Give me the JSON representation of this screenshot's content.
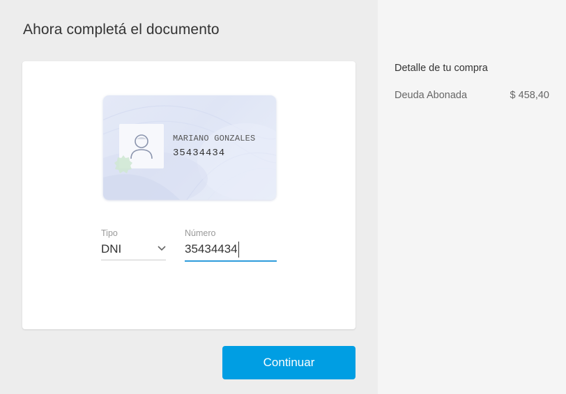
{
  "page": {
    "title": "Ahora completá el documento"
  },
  "id_card": {
    "name": "MARIANO GONZALES",
    "number": "35434434"
  },
  "form": {
    "tipo_label": "Tipo",
    "tipo_value": "DNI",
    "numero_label": "Número",
    "numero_value": "35434434"
  },
  "actions": {
    "continue_label": "Continuar"
  },
  "summary": {
    "title": "Detalle de tu compra",
    "item_label": "Deuda Abonada",
    "item_amount": "$ 458,40"
  },
  "colors": {
    "accent": "#009ee3",
    "input_underline": "#2d9cdb",
    "sidebar_bg": "#f5f5f5",
    "main_bg": "#ededed"
  },
  "icons": [
    "person-icon",
    "seal-icon",
    "chevron-down-icon"
  ]
}
